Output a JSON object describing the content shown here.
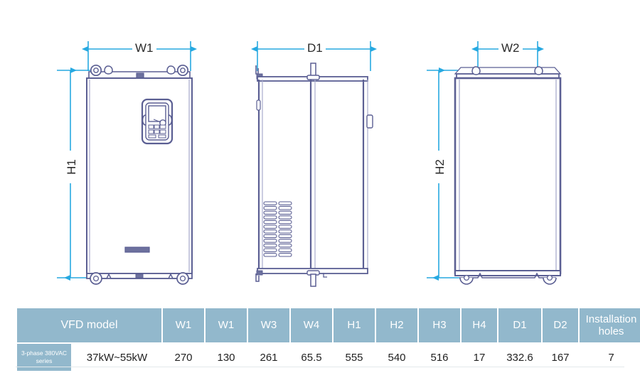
{
  "drawing": {
    "title": "VFD outline dimension drawing",
    "views": [
      {
        "name": "front-view",
        "dimension_labels": [
          "W1",
          "H1"
        ]
      },
      {
        "name": "side-view",
        "dimension_labels": [
          "D1"
        ]
      },
      {
        "name": "rear-view",
        "dimension_labels": [
          "W2",
          "H2"
        ]
      }
    ],
    "labels": {
      "w1": "W1",
      "h1": "H1",
      "d1": "D1",
      "w2": "W2",
      "h2": "H2"
    },
    "colors": {
      "dimension_line": "#27a9e1",
      "outline": "#5b5f93",
      "outline_light": "#8e92bd",
      "table_header": "#92b8cc",
      "table_text": "#ffffff"
    }
  },
  "table": {
    "headers": [
      "VFD model",
      "W1",
      "W1",
      "W3",
      "W4",
      "H1",
      "H2",
      "H3",
      "H4",
      "D1",
      "D2",
      "Installation holes"
    ],
    "row": {
      "series": "3-phase 380VAC series",
      "model": "37kW~55kW",
      "values": [
        "270",
        "130",
        "261",
        "65.5",
        "555",
        "540",
        "516",
        "17",
        "332.6",
        "167",
        "7"
      ]
    }
  }
}
